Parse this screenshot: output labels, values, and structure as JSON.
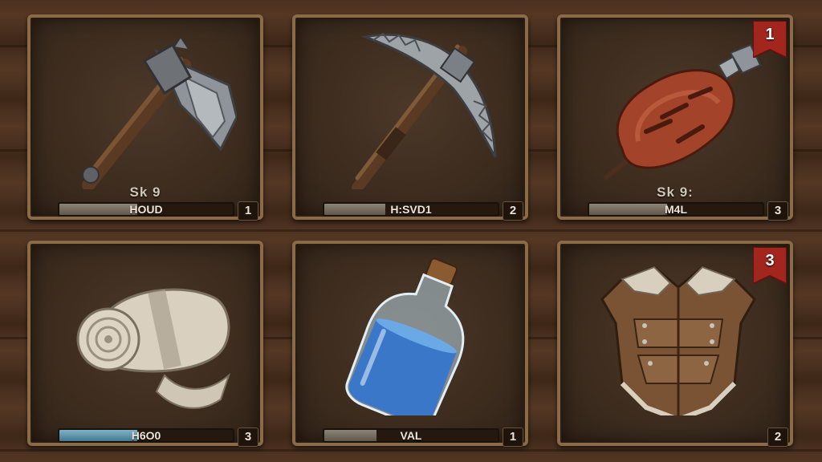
{
  "inventory": {
    "slots": [
      {
        "name": "axe",
        "icon": "stone-axe-icon",
        "stat": "Sk 9",
        "bar_label": "HOUD",
        "bar_fill": 0.45,
        "bar_color": "gray",
        "count": "1",
        "badge": ""
      },
      {
        "name": "pickaxe",
        "icon": "pickaxe-icon",
        "stat": "",
        "bar_label": "H:SVD1",
        "bar_fill": 0.35,
        "bar_color": "gray",
        "count": "2",
        "badge": ""
      },
      {
        "name": "meat",
        "icon": "roasted-meat-icon",
        "stat": "Sk 9:",
        "bar_label": "M4L",
        "bar_fill": 0.45,
        "bar_color": "gray",
        "count": "3",
        "badge": "1"
      },
      {
        "name": "bandage",
        "icon": "bandage-roll-icon",
        "stat": "",
        "bar_label": "H6O0",
        "bar_fill": 0.45,
        "bar_color": "blue",
        "count": "3",
        "badge": ""
      },
      {
        "name": "water-bottle",
        "icon": "water-bottle-icon",
        "stat": "",
        "bar_label": "VAL",
        "bar_fill": 0.3,
        "bar_color": "gray",
        "count": "1",
        "badge": ""
      },
      {
        "name": "leather-armor",
        "icon": "leather-armor-icon",
        "stat": "",
        "bar_label": "",
        "bar_fill": 0,
        "bar_color": "gray",
        "count": "2",
        "badge": "3"
      }
    ],
    "badge_color": "#a3261e"
  }
}
